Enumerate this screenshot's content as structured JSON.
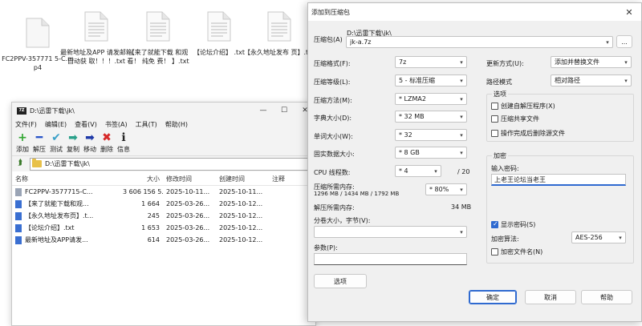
{
  "desktop": {
    "files": [
      {
        "name": "FC2PPV-357771 5-C.mp4"
      },
      {
        "name": "最新地址及APP 请发邮箱自动获 取！！！.txt"
      },
      {
        "name": "【来了就能下载 和观看！ 纯免 费！ 】.txt"
      },
      {
        "name": "【论坛介绍】 .txt"
      },
      {
        "name": "【永久地址发布 页】.txt"
      }
    ]
  },
  "file_manager": {
    "title": "D:\\迅雷下载\\jk\\",
    "logo_text": "7Z",
    "window_controls": [
      "—",
      "☐",
      "✕"
    ],
    "menu": [
      "文件(F)",
      "编辑(E)",
      "查看(V)",
      "书签(A)",
      "工具(T)",
      "帮助(H)"
    ],
    "toolbar": [
      {
        "label": "添加",
        "glyph": "+",
        "color": "#2fa52f"
      },
      {
        "label": "解压",
        "glyph": "━",
        "color": "#2a55c9"
      },
      {
        "label": "测试",
        "glyph": "✔",
        "color": "#3aa0c8"
      },
      {
        "label": "复制",
        "glyph": "➡",
        "color": "#2aa08a"
      },
      {
        "label": "移动",
        "glyph": "➡",
        "color": "#1f3aa8"
      },
      {
        "label": "删除",
        "glyph": "✖",
        "color": "#d62828"
      },
      {
        "label": "信息",
        "glyph": "ℹ",
        "color": "#222222"
      }
    ],
    "path": "D:\\迅雷下载\\jk\\",
    "columns": {
      "name": "名称",
      "size": "大小",
      "modified": "修改时间",
      "created": "创建时间",
      "comment": "注释"
    },
    "rows": [
      {
        "name": "FC2PPV-3577715-C...",
        "size": "3 606 156 5...",
        "modified": "2025-10-11...",
        "created": "2025-10-11...",
        "type": "video"
      },
      {
        "name": "【来了就能下载和观...",
        "size": "1 664",
        "modified": "2025-03-26...",
        "created": "2025-10-12...",
        "type": "txt"
      },
      {
        "name": "【永久地址发布页】.t...",
        "size": "245",
        "modified": "2025-03-26...",
        "created": "2025-10-12...",
        "type": "txt"
      },
      {
        "name": "【论坛介绍】.txt",
        "size": "1 653",
        "modified": "2025-03-26...",
        "created": "2025-10-12...",
        "type": "txt"
      },
      {
        "name": "最新地址及APP请发...",
        "size": "614",
        "modified": "2025-03-26...",
        "created": "2025-10-12...",
        "type": "txt"
      }
    ]
  },
  "dialog": {
    "title": "添加到压缩包",
    "close_glyph": "✕",
    "archive_label": "压缩包(A)",
    "archive_dir": "D:\\迅雷下载\\jk\\",
    "archive_name": "jk-a.7z",
    "browse_label": "...",
    "left": {
      "format_label": "压缩格式(F):",
      "format_value": "7z",
      "level_label": "压缩等级(L):",
      "level_value": "5 - 标准压缩",
      "method_label": "压缩方法(M):",
      "method_value": "* LZMA2",
      "dict_label": "字典大小(D):",
      "dict_value": "* 32 MB",
      "word_label": "单词大小(W):",
      "word_value": "* 32",
      "solid_label": "固实数据大小:",
      "solid_value": "* 8 GB",
      "threads_label": "CPU 线程数:",
      "threads_value": "* 4",
      "threads_total": "/ 20",
      "mem_label": "压缩所需内存:",
      "mem_detail": "1296 MB / 1434 MB / 1792 MB",
      "mem_value": "* 80%",
      "decomp_label": "解压所需内存:",
      "decomp_value": "34 MB",
      "split_label": "分卷大小，字节(V):",
      "split_value": "",
      "params_label": "参数(P):",
      "params_value": "",
      "options_button": "选项"
    },
    "right": {
      "update_label": "更新方式(U):",
      "update_value": "添加并替换文件",
      "path_label": "路径模式",
      "path_value": "相对路径",
      "options_group": "选项",
      "opt_sfx": "创建自解压程序(X)",
      "opt_shared": "压缩共享文件",
      "opt_delete": "操作完成后删除源文件",
      "encrypt_group": "加密",
      "password_label": "输入密码:",
      "password_value": "上老王论坛当老王",
      "show_password": "显示密码(S)",
      "method_label": "加密算法:",
      "method_value": "AES-256",
      "encrypt_names": "加密文件名(N)"
    },
    "buttons": {
      "ok": "确定",
      "cancel": "取消",
      "help": "帮助"
    }
  }
}
